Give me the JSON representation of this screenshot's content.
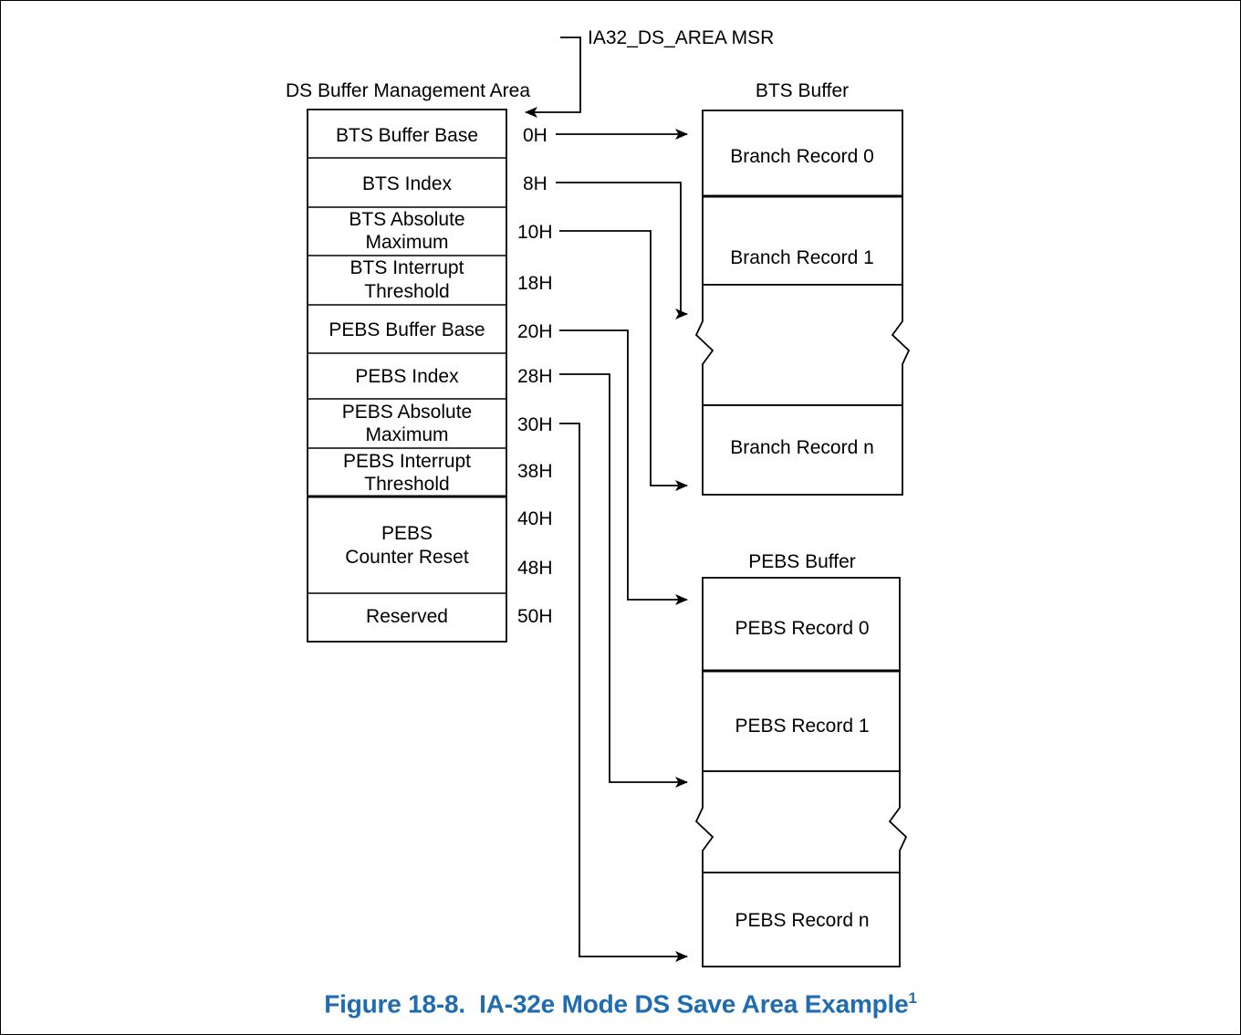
{
  "figure": {
    "caption_label": "Figure 18-8.",
    "caption_title": "IA-32e Mode DS Save Area Example",
    "caption_footnote_marker": "1",
    "caption_color": "#1f6cb0"
  },
  "msr": {
    "label": "IA32_DS_AREA MSR"
  },
  "ds_area": {
    "title": "DS Buffer Management Area",
    "fields": [
      {
        "label": "BTS Buffer Base",
        "offset": "0H"
      },
      {
        "label": "BTS Index",
        "offset": "8H"
      },
      {
        "label": "BTS Absolute Maximum",
        "offset": "10H"
      },
      {
        "label": "BTS Interrupt Threshold",
        "offset": "18H"
      },
      {
        "label": "PEBS Buffer Base",
        "offset": "20H"
      },
      {
        "label": "PEBS Index",
        "offset": "28H"
      },
      {
        "label": "PEBS Absolute Maximum",
        "offset": "30H"
      },
      {
        "label": "PEBS Interrupt Threshold",
        "offset": "38H"
      },
      {
        "label": "PEBS Counter Reset",
        "offset": "40H"
      },
      {
        "label": "",
        "offset": "48H"
      },
      {
        "label": "Reserved",
        "offset": "50H"
      }
    ]
  },
  "bts_buffer": {
    "title": "BTS Buffer",
    "records": [
      "Branch Record 0",
      "Branch Record 1",
      "Branch Record n"
    ],
    "last_record_prefix": "Branch Record ",
    "last_record_index": "n"
  },
  "pebs_buffer": {
    "title": "PEBS Buffer",
    "records": [
      "PEBS Record 0",
      "PEBS Record 1",
      "PEBS Record n"
    ]
  },
  "colors": {
    "stroke": "#000000",
    "background": "#ffffff",
    "caption": "#1f6cb0"
  }
}
